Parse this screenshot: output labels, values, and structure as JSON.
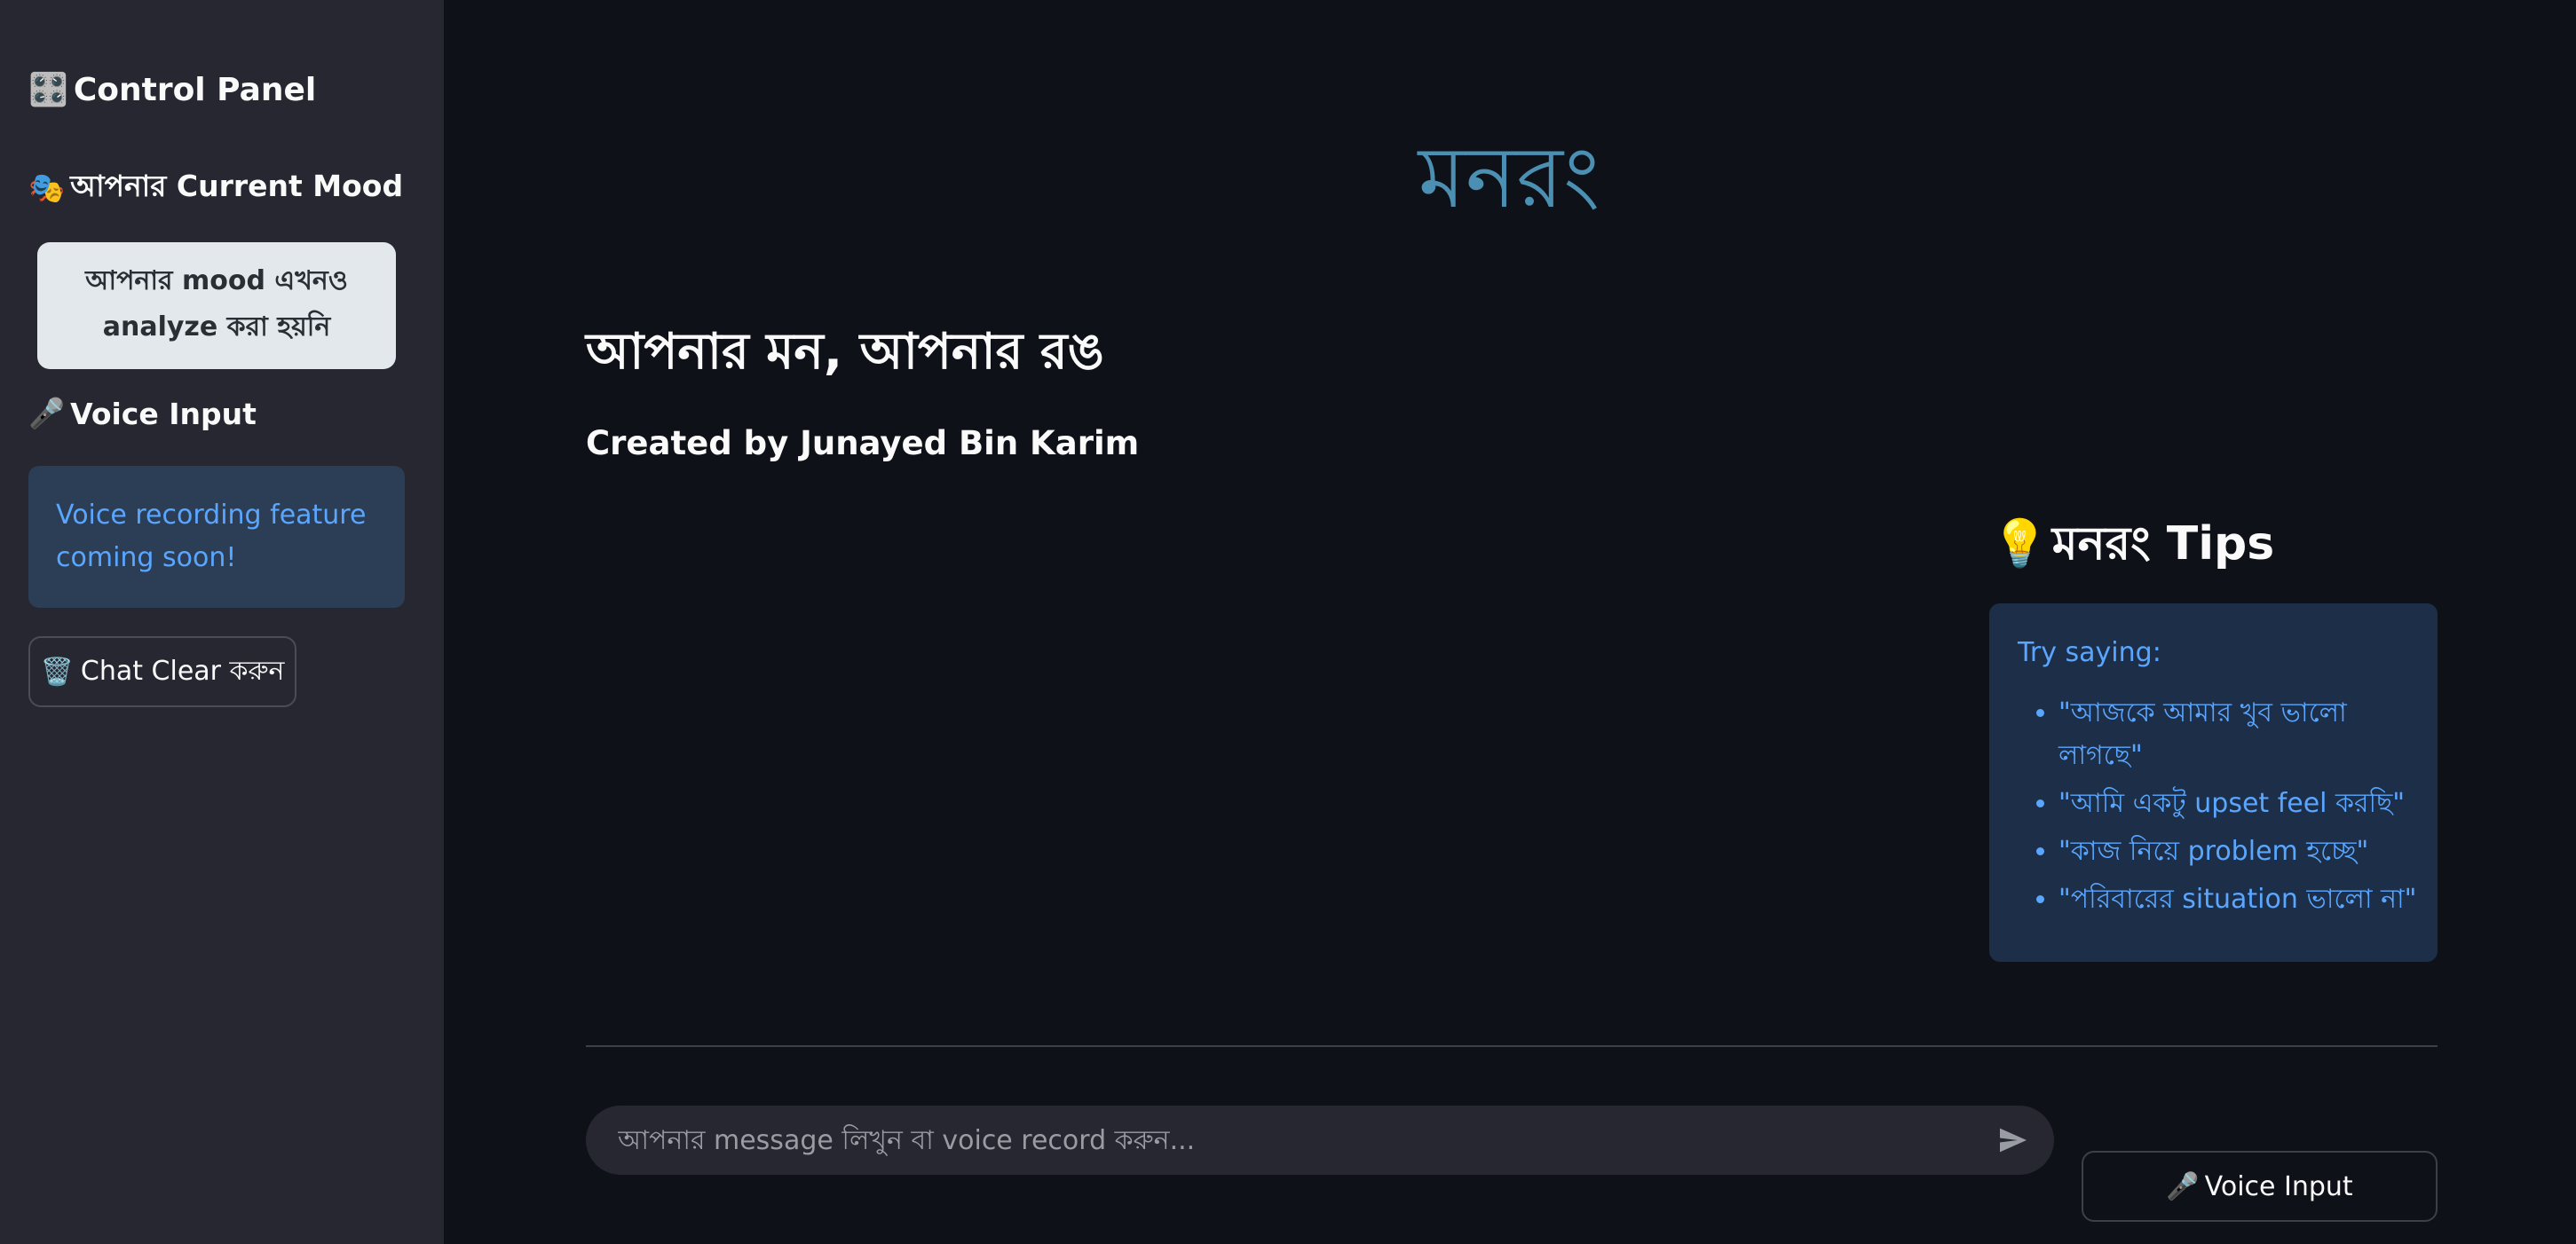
{
  "sidebar": {
    "control_panel": {
      "icon": "🎛️",
      "label": "Control Panel"
    },
    "mood_heading": {
      "icon": "🎭",
      "label": "আপনার Current Mood"
    },
    "mood_status": "আপনার mood এখনও analyze করা হয়নি",
    "voice_heading": {
      "icon": "🎤",
      "label": "Voice Input"
    },
    "voice_info": "Voice recording feature coming soon!",
    "clear_button": {
      "icon": "🗑️",
      "label": "Chat Clear করুন"
    }
  },
  "main": {
    "title": "মনরং",
    "subtitle": "আপনার মন, আপনার রঙ",
    "credit": "Created by Junayed Bin Karim",
    "tips": {
      "icon": "💡",
      "heading": "মনরং Tips",
      "intro": "Try saying:",
      "items": [
        "\"আজকে আমার খুব ভালো লাগছে\"",
        "\"আমি একটু upset feel করছি\"",
        "\"কাজ নিয়ে problem হচ্ছে\"",
        "\"পরিবারের situation ভালো না\""
      ]
    },
    "chat": {
      "placeholder": "আপনার message লিখুন বা voice record করুন..."
    },
    "voice_button": {
      "icon": "🎤",
      "label": "Voice Input"
    }
  },
  "colors": {
    "background": "#0e1117",
    "sidebar": "#262730",
    "title": "#4b8fb3",
    "info_text": "#5aa6ff",
    "info_box": "#2c3e56",
    "tips_box": "#1d2f48",
    "mood_card": "#e3e8ec"
  }
}
